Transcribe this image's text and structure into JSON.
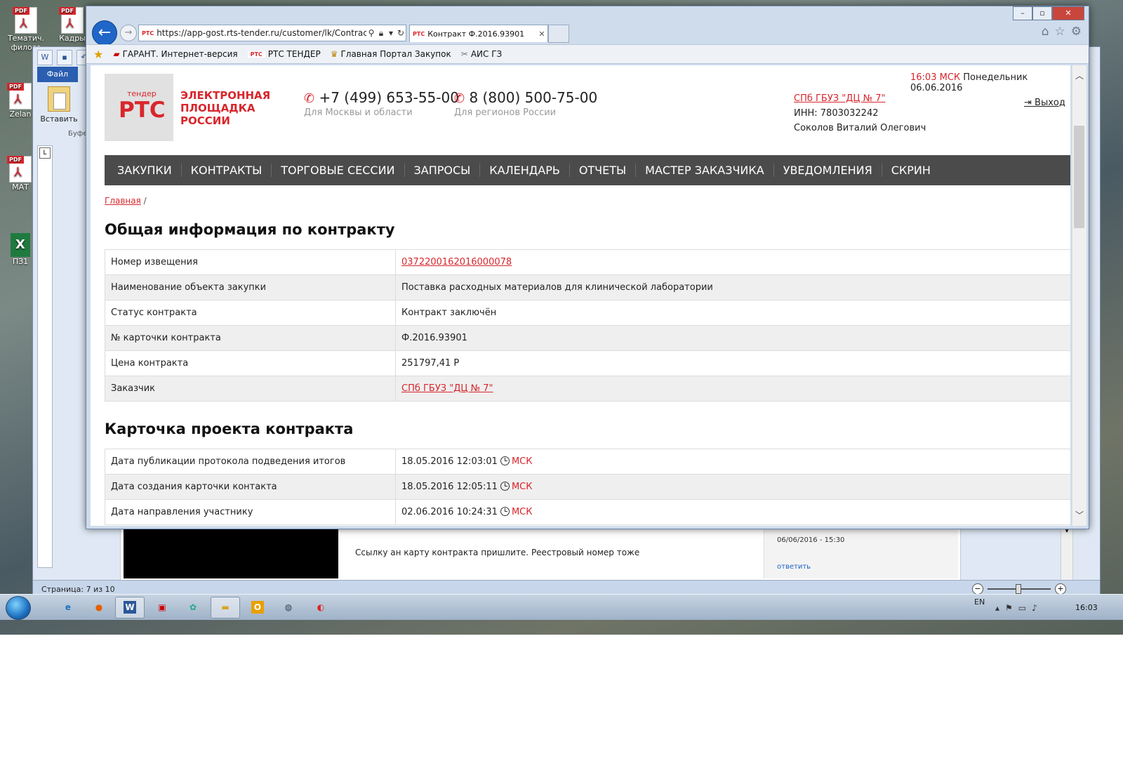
{
  "desktop": {
    "icons": [
      {
        "label": "Тематич. филосо",
        "kind": "pdf"
      },
      {
        "label": "Кадры",
        "kind": "pdf"
      },
      {
        "label": "Zelan",
        "kind": "pdf"
      },
      {
        "label": "МАТ",
        "kind": "pdf"
      },
      {
        "label": "ПЗ1",
        "kind": "xls"
      }
    ]
  },
  "word": {
    "file_tab": "Файл",
    "paste_label": "Вставить",
    "buffer_label": "Буфе",
    "ruler_marker": "L",
    "status_page": "Страница: 7 из 10",
    "zoom_minus": "−",
    "zoom_plus": "+",
    "message": "Ссылку ан карту контракта пришлите. Реестровый номер тоже",
    "comment_date": "06/06/2016 - 15:30",
    "reply_label": "ответить"
  },
  "browser": {
    "address": "https://app-gost.rts-tender.ru/customer/lk/Contracts/V",
    "favicon": "РТС",
    "tab_title": "Контракт Ф.2016.93901",
    "favorites": [
      {
        "label": "ГАРАНТ. Интернет-версия"
      },
      {
        "label": "РТС ТЕНДЕР"
      },
      {
        "label": "Главная Портал Закупок"
      },
      {
        "label": "АИС ГЗ"
      }
    ]
  },
  "site": {
    "logo_small": "тендер",
    "logo_big": "РТС",
    "logo_text_1": "ЭЛЕКТРОННАЯ",
    "logo_text_2": "ПЛОЩАДКА",
    "logo_text_3": "РОССИИ",
    "phone1": "+7 (499) 653-55-00",
    "phone1_sub": "Для Москвы и области",
    "phone2": "8 (800) 500-75-00",
    "phone2_sub": "Для регионов России",
    "time": "16:03 МСК",
    "date": "Понедельник 06.06.2016",
    "org_name": "СПб ГБУЗ \"ДЦ № 7\"",
    "org_inn": "ИНН: 7803032242",
    "org_user": "Соколов Виталий Олегович",
    "logout": "Выход",
    "menu": [
      "ЗАКУПКИ",
      "КОНТРАКТЫ",
      "ТОРГОВЫЕ СЕССИИ",
      "ЗАПРОСЫ",
      "КАЛЕНДАРЬ",
      "ОТЧЕТЫ",
      "МАСТЕР ЗАКАЗЧИКА",
      "УВЕДОМЛЕНИЯ",
      "СКРИН"
    ],
    "breadcrumb_home": "Главная",
    "breadcrumb_sep": "/",
    "section1_title": "Общая информация по контракту",
    "general_info": [
      {
        "label": "Номер извещения",
        "value": "0372200162016000078"
      },
      {
        "label": "Наименование объекта закупки",
        "value": "Поставка расходных материалов для клинической лаборатории"
      },
      {
        "label": "Статус контракта",
        "value": "Контракт заключён"
      },
      {
        "label": "№ карточки контракта",
        "value": "Ф.2016.93901"
      },
      {
        "label": "Цена контракта",
        "value": "251797,41 Р"
      },
      {
        "label": "Заказчик",
        "value": "СПб ГБУЗ \"ДЦ № 7\""
      }
    ],
    "section2_title": "Карточка проекта контракта",
    "project_card": [
      {
        "label": "Дата публикации протокола подведения итогов",
        "value": "18.05.2016 12:03:01",
        "tz": "МСК"
      },
      {
        "label": "Дата создания карточки контакта",
        "value": "18.05.2016 12:05:11",
        "tz": "МСК"
      },
      {
        "label": "Дата направления участнику",
        "value": "02.06.2016 10:24:31",
        "tz": "МСК"
      }
    ]
  },
  "taskbar": {
    "lang": "EN",
    "time": "16:03"
  },
  "colors": {
    "accent": "#d8262c",
    "menu_bg": "#4b4b4b"
  }
}
